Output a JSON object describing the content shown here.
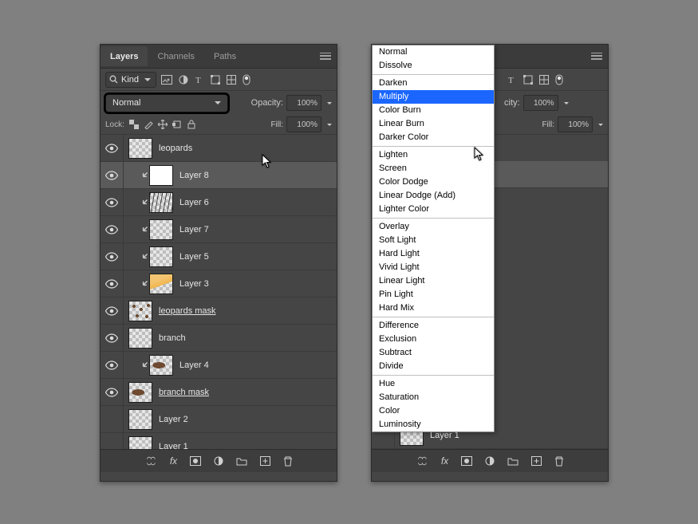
{
  "tabs": {
    "layers": "Layers",
    "channels": "Channels",
    "paths": "Paths"
  },
  "filterLabel": "Kind",
  "blendMode": "Normal",
  "opacityLabel": "Opacity:",
  "opacityValue": "100%",
  "lockLabel": "Lock:",
  "fillLabel": "Fill:",
  "fillValue": "100%",
  "layers": [
    {
      "name": "leopards",
      "indent": 0,
      "thumb": "trans",
      "visible": true,
      "underline": false
    },
    {
      "name": "Layer 8",
      "indent": 1,
      "thumb": "white",
      "visible": true,
      "underline": false,
      "selected": true
    },
    {
      "name": "Layer 6",
      "indent": 1,
      "thumb": "art-scrib",
      "visible": true,
      "underline": false
    },
    {
      "name": "Layer 7",
      "indent": 1,
      "thumb": "trans",
      "visible": true,
      "underline": false
    },
    {
      "name": "Layer 5",
      "indent": 1,
      "thumb": "trans",
      "visible": true,
      "underline": false
    },
    {
      "name": "Layer 3",
      "indent": 1,
      "thumb": "art-gold",
      "visible": true,
      "underline": false
    },
    {
      "name": "leopards mask",
      "indent": 0,
      "thumb": "art-spots",
      "visible": true,
      "underline": true
    },
    {
      "name": "branch",
      "indent": 0,
      "thumb": "trans",
      "visible": true,
      "underline": false
    },
    {
      "name": "Layer 4",
      "indent": 1,
      "thumb": "art-brown",
      "visible": true,
      "underline": false
    },
    {
      "name": "branch mask",
      "indent": 0,
      "thumb": "art-brown",
      "visible": true,
      "underline": true
    },
    {
      "name": "Layer 2",
      "indent": 0,
      "thumb": "trans",
      "visible": false,
      "underline": false
    },
    {
      "name": "Layer 1",
      "indent": 0,
      "thumb": "trans",
      "visible": false,
      "underline": false
    }
  ],
  "rightVisibleLayer": {
    "name": "Layer 1"
  },
  "blendModes": {
    "selected": "Multiply",
    "groups": [
      [
        "Normal",
        "Dissolve"
      ],
      [
        "Darken",
        "Multiply",
        "Color Burn",
        "Linear Burn",
        "Darker Color"
      ],
      [
        "Lighten",
        "Screen",
        "Color Dodge",
        "Linear Dodge (Add)",
        "Lighter Color"
      ],
      [
        "Overlay",
        "Soft Light",
        "Hard Light",
        "Vivid Light",
        "Linear Light",
        "Pin Light",
        "Hard Mix"
      ],
      [
        "Difference",
        "Exclusion",
        "Subtract",
        "Divide"
      ],
      [
        "Hue",
        "Saturation",
        "Color",
        "Luminosity"
      ]
    ]
  }
}
